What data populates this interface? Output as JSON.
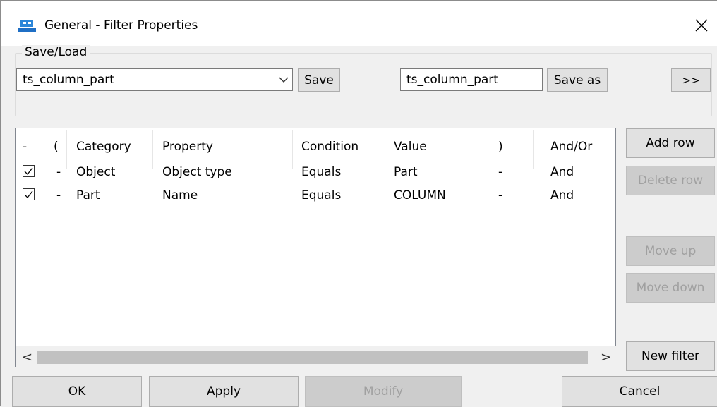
{
  "window": {
    "title": "General - Filter Properties",
    "app_icon": "tekla-app-icon",
    "close_icon": "close-icon"
  },
  "save_load": {
    "legend": "Save/Load",
    "combo_value": "ts_column_part",
    "save_label": "Save",
    "save_as_value": "ts_column_part",
    "save_as_label": "Save as",
    "more_label": ">>"
  },
  "grid": {
    "headers": [
      "-",
      "(",
      "Category",
      "Property",
      "Condition",
      "Value",
      ")",
      "And/Or"
    ],
    "rows": [
      {
        "checked": true,
        "open": "-",
        "category": "Object",
        "property": "Object type",
        "condition": "Equals",
        "value": "Part",
        "close": "-",
        "andor": "And"
      },
      {
        "checked": true,
        "open": "-",
        "category": "Part",
        "property": "Name",
        "condition": "Equals",
        "value": "COLUMN",
        "close": "-",
        "andor": "And"
      }
    ],
    "scroll_left": "<",
    "scroll_right": ">"
  },
  "side_buttons": {
    "add_row": "Add row",
    "delete_row": "Delete row",
    "move_up": "Move up",
    "move_down": "Move down",
    "new_filter": "New filter"
  },
  "bottom_buttons": {
    "ok": "OK",
    "apply": "Apply",
    "modify": "Modify",
    "cancel": "Cancel"
  },
  "colors": {
    "accent": "#0078d7",
    "disabled_text": "#a0a0a0"
  }
}
